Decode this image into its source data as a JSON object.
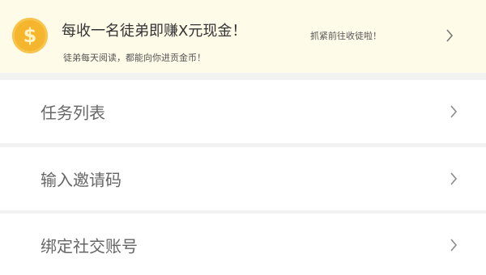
{
  "promo": {
    "coin_icon": "coin-icon",
    "coin_symbol": "$",
    "title": "每收一名徒弟即赚X元现金！",
    "subtitle": "徒弟每天阅读，都能向你进贡金币！",
    "action_label": "抓紧前往收徒啦！",
    "accent_color": "#f5b52c"
  },
  "menu": {
    "items": [
      {
        "label": "任务列表",
        "icon": "chevron-right-icon"
      },
      {
        "label": "输入邀请码",
        "icon": "chevron-right-icon"
      },
      {
        "label": "绑定社交账号",
        "icon": "chevron-right-icon"
      }
    ]
  }
}
